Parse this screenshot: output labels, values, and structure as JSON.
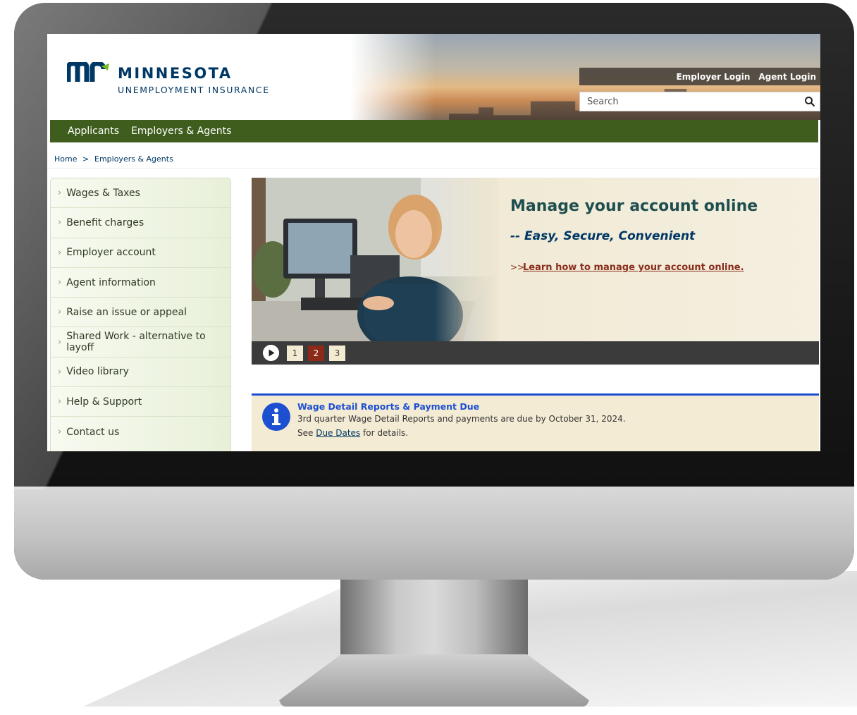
{
  "brand": {
    "name": "MINNESOTA",
    "subtitle": "UNEMPLOYMENT INSURANCE"
  },
  "header": {
    "employer_login": "Employer Login",
    "agent_login": "Agent Login",
    "search_placeholder": "Search"
  },
  "nav": {
    "items": [
      "Applicants",
      "Employers & Agents"
    ]
  },
  "breadcrumb": {
    "home": "Home",
    "separator": ">",
    "current": "Employers & Agents"
  },
  "sidebar": {
    "items": [
      "Wages & Taxes",
      "Benefit charges",
      "Employer account",
      "Agent information",
      "Raise an issue or appeal",
      "Shared Work - alternative to layoff",
      "Video library",
      "Help & Support",
      "Contact us"
    ]
  },
  "hero": {
    "title": "Manage your account online",
    "subtitle": "-- Easy, Secure, Convenient",
    "link_prefix": ">>",
    "link_text": " Learn how to manage your account online.",
    "pages": [
      "1",
      "2",
      "3"
    ],
    "active_page": "2"
  },
  "alert": {
    "title": "Wage Detail Reports & Payment Due",
    "text": "3rd quarter Wage Detail Reports and payments are due by October 31, 2024.",
    "text2_before": "See ",
    "text2_link": "Due Dates",
    "text2_after": " for details."
  },
  "colors": {
    "nav_green": "#3f5e1d",
    "brand_blue": "#003865",
    "active_page": "#8c2a17",
    "alert_blue": "#1d4fd0"
  },
  "icons": [
    "search-icon",
    "chevron-right-icon",
    "play-icon",
    "info-icon",
    "mn-logo-icon"
  ]
}
